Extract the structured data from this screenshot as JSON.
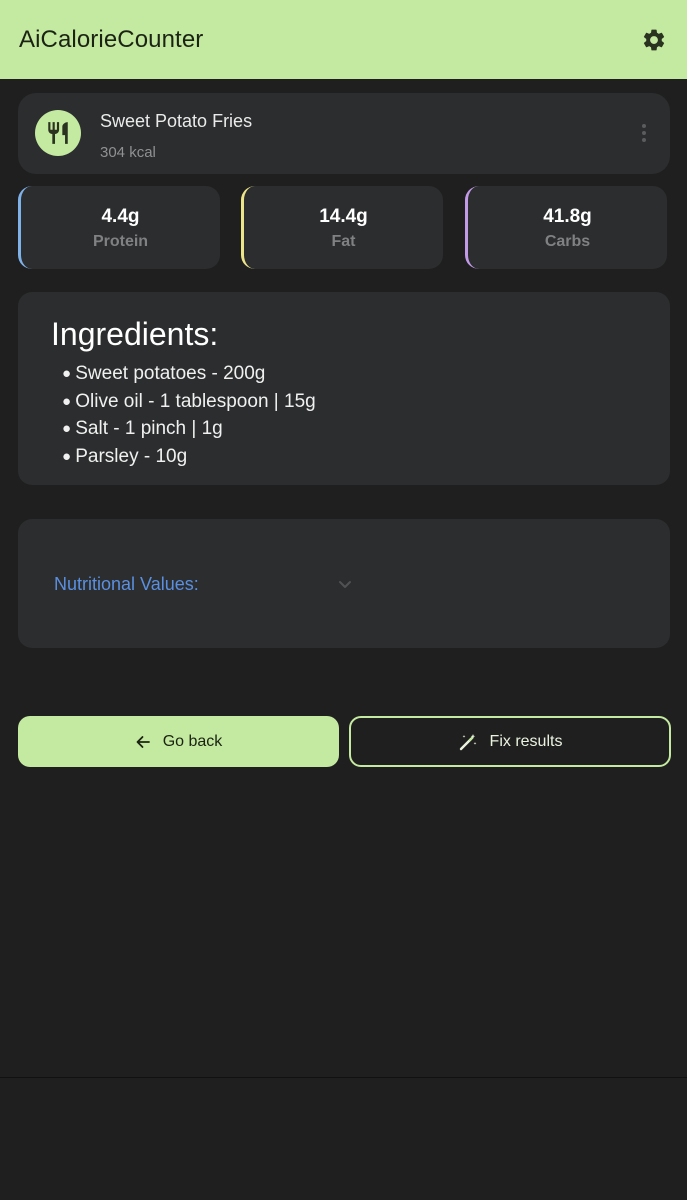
{
  "app": {
    "title": "AiCalorieCounter"
  },
  "food": {
    "name": "Sweet Potato Fries",
    "kcal": "304 kcal"
  },
  "macros": [
    {
      "value": "4.4g",
      "label": "Protein",
      "color": "#7fb2e8"
    },
    {
      "value": "14.4g",
      "label": "Fat",
      "color": "#ede58a"
    },
    {
      "value": "41.8g",
      "label": "Carbs",
      "color": "#c39ae8"
    }
  ],
  "ingredients": {
    "title": "Ingredients:",
    "items": [
      "Sweet potatoes - 200g",
      "Olive oil - 1 tablespoon | 15g",
      "Salt - 1 pinch | 1g",
      "Parsley - 10g"
    ]
  },
  "nutrition": {
    "label": "Nutritional Values:"
  },
  "actions": {
    "back_label": "Go back",
    "fix_label": "Fix results"
  },
  "colors": {
    "accent": "#c4e9a0",
    "background": "#1f1f1f",
    "card": "#2b2d2e",
    "link": "#5b8fe0"
  }
}
